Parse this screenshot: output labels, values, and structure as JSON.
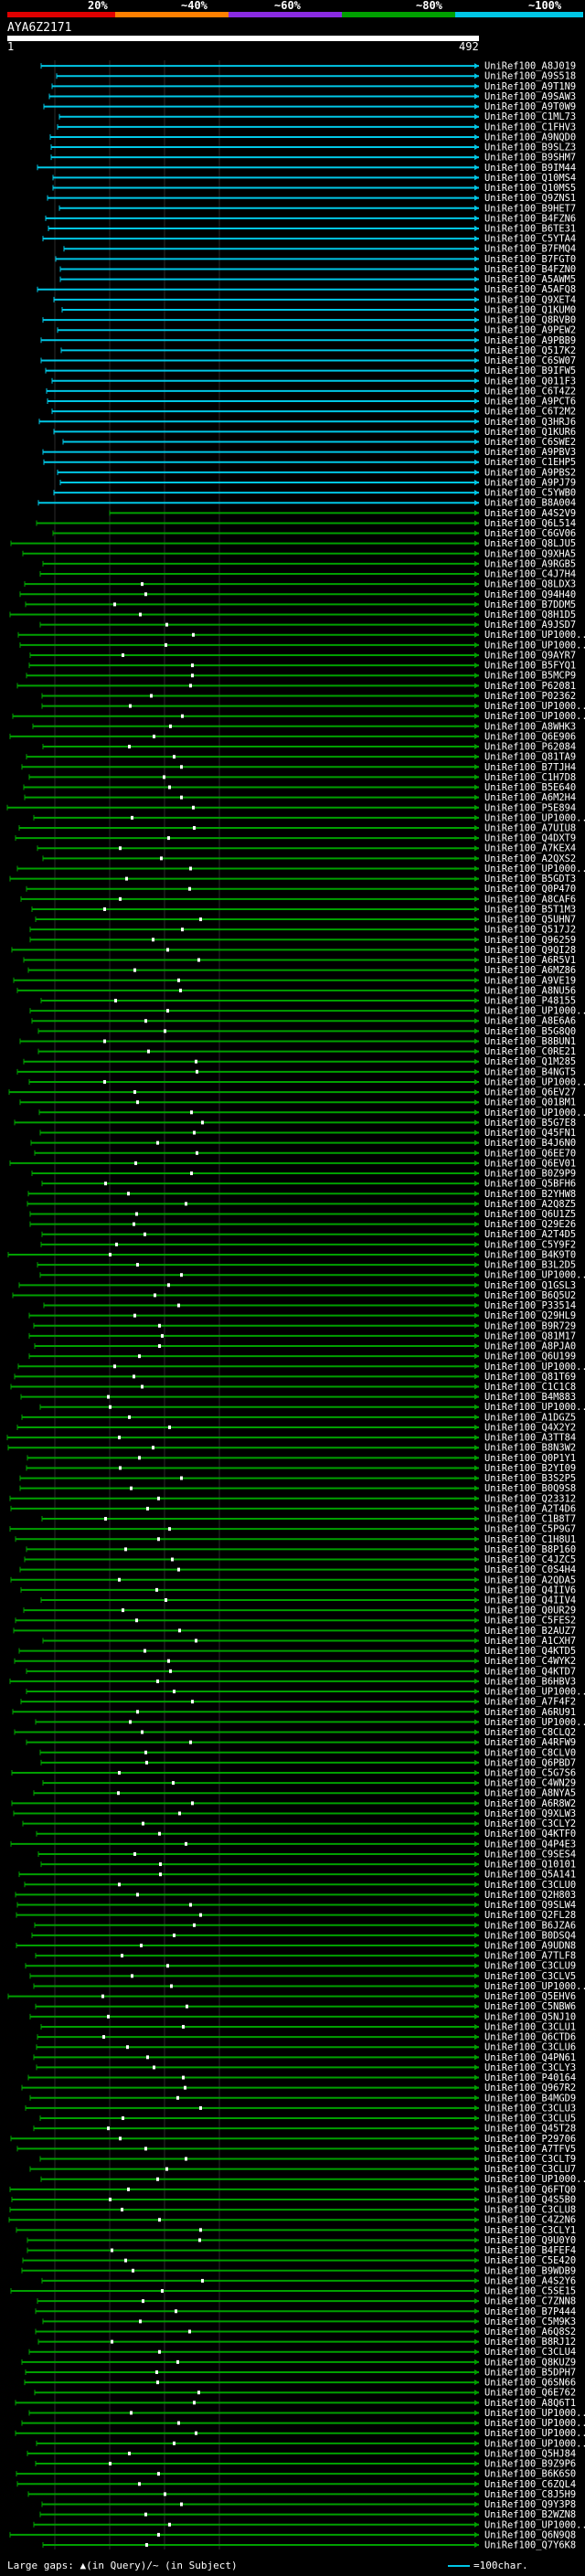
{
  "coverage_scale": {
    "labels": [
      "20%",
      "~40%",
      "~60%",
      "~80%",
      "~100%"
    ],
    "colors": [
      "#e00000",
      "#ff8000",
      "#8a2be2",
      "#00a000",
      "#00c7e6"
    ]
  },
  "query": {
    "name": "AYA6Z2171",
    "start": "1",
    "end": "492"
  },
  "hit_labels": [
    "UniRef100_A8J019",
    "UniRef100_A9S518",
    "UniRef100_A9T1N9",
    "UniRef100_A9SAW3",
    "UniRef100_A9T0W9",
    "UniRef100_C1ML73",
    "UniRef100_C1FHV3",
    "UniRef100_A9NQD0",
    "UniRef100_B9SLZ3",
    "UniRef100_B9SHM7",
    "UniRef100_B9IM44",
    "UniRef100_Q10MS4",
    "UniRef100_Q10MS5",
    "UniRef100_Q9ZNS1",
    "UniRef100_B9HET7",
    "UniRef100_B4FZN6",
    "UniRef100_B6TE31",
    "UniRef100_C5YTA4",
    "UniRef100_B7FMQ4",
    "UniRef100_B7FGT0",
    "UniRef100_B4FZN0",
    "UniRef100_A5AWM5",
    "UniRef100_A5AFQ8",
    "UniRef100_Q9XET4",
    "UniRef100_Q1KUM0",
    "UniRef100_Q8RVB0",
    "UniRef100_A9PEW2",
    "UniRef100_A9PBB9",
    "UniRef100_Q517K2",
    "UniRef100_C6SW07",
    "UniRef100_B9IFW5",
    "UniRef100_Q011F3",
    "UniRef100_C6T4Z2",
    "UniRef100_A9PCT6",
    "UniRef100_C6T2M2",
    "UniRef100_Q3HRJ6",
    "UniRef100_Q1KUR6",
    "UniRef100_C6SWE2",
    "UniRef100_A9PBV3",
    "UniRef100_C1EHP5",
    "UniRef100_A9PBS2",
    "UniRef100_A9PJ79",
    "UniRef100_C5YWB0",
    "UniRef100_B8A004",
    "UniRef100_A4S2V9",
    "UniRef100_Q6L514",
    "UniRef100_C6GV06",
    "UniRef100_Q8LJU5",
    "UniRef100_Q9XHA5",
    "UniRef100_A9RGB5",
    "UniRef100_C4J7H4",
    "UniRef100_Q8LDX3",
    "UniRef100_Q94H40",
    "UniRef100_B7DDM5",
    "UniRef100_Q8H1D5",
    "UniRef100_A9JSD7",
    "UniRef100_UP1000...",
    "UniRef100_UP1000...",
    "UniRef100_Q9AYR7",
    "UniRef100_B5FYQ1",
    "UniRef100_B5MCP9",
    "UniRef100_P62081",
    "UniRef100_P02362",
    "UniRef100_UP1000...",
    "UniRef100_UP1000...",
    "UniRef100_A8WHK3",
    "UniRef100_Q6E906",
    "UniRef100_P62084",
    "UniRef100_Q81TA9",
    "UniRef100_B7TJH4",
    "UniRef100_C1H7D8",
    "UniRef100_B5E640",
    "UniRef100_A6M2H4",
    "UniRef100_P5E894",
    "UniRef100_UP1000...",
    "UniRef100_A7UIU8",
    "UniRef100_Q4DXT9",
    "UniRef100_A7KEX4",
    "UniRef100_A2QXS2",
    "UniRef100_UP1000...",
    "UniRef100_B5GDT3",
    "UniRef100_Q0P470",
    "UniRef100_A8CAF6",
    "UniRef100_B5T1M3",
    "UniRef100_Q5UHN7",
    "UniRef100_Q517J2",
    "UniRef100_Q96259",
    "UniRef100_Q9QI28",
    "UniRef100_A6R5V1",
    "UniRef100_A6MZ86",
    "UniRef100_A9VE19",
    "UniRef100_A8NU56",
    "UniRef100_P48155",
    "UniRef100_UP1000...",
    "UniRef100_A8E6A6",
    "UniRef100_B5G8Q0",
    "UniRef100_B8BUN1",
    "UniRef100_C0RE21",
    "UniRef100_Q1M285",
    "UniRef100_B4NGT5",
    "UniRef100_UP1000...",
    "UniRef100_Q6EV27",
    "UniRef100_Q01BM1",
    "UniRef100_UP1000...",
    "UniRef100_B5G7E8",
    "UniRef100_Q45FN1",
    "UniRef100_B4J6N0",
    "UniRef100_Q6EE70",
    "UniRef100_Q6EV01",
    "UniRef100_B0Z9P9",
    "UniRef100_Q5BFH6",
    "UniRef100_B2YHW8",
    "UniRef100_A2Q8Z5",
    "UniRef100_Q6U1Z5",
    "UniRef100_Q29E26",
    "UniRef100_A2T4D5",
    "UniRef100_C5Y9F2",
    "UniRef100_B4K9T0",
    "UniRef100_B3L2D5",
    "UniRef100_UP1000...",
    "UniRef100_Q1GSL3",
    "UniRef100_B6Q5U2",
    "UniRef100_P33514",
    "UniRef100_Q29HL9",
    "UniRef100_B9R729",
    "UniRef100_Q81M17",
    "UniRef100_A8PJA0",
    "UniRef100_Q6U199",
    "UniRef100_UP1000...",
    "UniRef100_Q81T69",
    "UniRef100_C1C1C8",
    "UniRef100_B4M883",
    "UniRef100_UP1000...",
    "UniRef100_A1DGZ5",
    "UniRef100_Q4X2Y2",
    "UniRef100_A3TT84",
    "UniRef100_B8N3W2",
    "UniRef100_Q0P1Y1",
    "UniRef100_B2YI09",
    "UniRef100_B3S2P5",
    "UniRef100_B0Q9S8",
    "UniRef100_Q23312",
    "UniRef100_A2T4D6",
    "UniRef100_C1B8T7",
    "UniRef100_C5P9G7",
    "UniRef100_C1H8U1",
    "UniRef100_B8P160",
    "UniRef100_C4JZC5",
    "UniRef100_C0S4H4",
    "UniRef100_A2QDA5",
    "UniRef100_Q4IIV6",
    "UniRef100_Q4IIV4",
    "UniRef100_Q0UR29",
    "UniRef100_C5FES2",
    "UniRef100_B2AUZ7",
    "UniRef100_A1CXH7",
    "UniRef100_Q4KTD5",
    "UniRef100_C4WYK2",
    "UniRef100_Q4KTD7",
    "UniRef100_B6HBV3",
    "UniRef100_UP1000...",
    "UniRef100_A7F4F2",
    "UniRef100_A6RU91",
    "UniRef100_UP1000...",
    "UniRef100_C8CLQ2",
    "UniRef100_A4RFW9",
    "UniRef100_C8CLV0",
    "UniRef100_Q6PBD7",
    "UniRef100_C5G7S6",
    "UniRef100_C4WN29",
    "UniRef100_A8NYA5",
    "UniRef100_A6R8W2",
    "UniRef100_Q9XLW3",
    "UniRef100_C3CLY2",
    "UniRef100_Q4KTF0",
    "UniRef100_Q4P4E3",
    "UniRef100_C9SES4",
    "UniRef100_Q10101",
    "UniRef100_Q5A141",
    "UniRef100_C3CLU0",
    "UniRef100_Q2H803",
    "UniRef100_Q9SLW4",
    "UniRef100_Q2FL28",
    "UniRef100_B6JZA6",
    "UniRef100_B0DSQ4",
    "UniRef100_A9UDN8",
    "UniRef100_A7TLF8",
    "UniRef100_C3CLU9",
    "UniRef100_C3CLV5",
    "UniRef100_UP1000...",
    "UniRef100_Q5EHV6",
    "UniRef100_C5NBW6",
    "UniRef100_Q5NJ10",
    "UniRef100_C3CLU1",
    "UniRef100_Q6CTD6",
    "UniRef100_C3CLU6",
    "UniRef100_Q4PN61",
    "UniRef100_C3CLY3",
    "UniRef100_P40164",
    "UniRef100_Q967R2",
    "UniRef100_B4MGD9",
    "UniRef100_C3CLU3",
    "UniRef100_C3CLU5",
    "UniRef100_Q45T28",
    "UniRef100_P29706",
    "UniRef100_A7TFV5",
    "UniRef100_C3CLT9",
    "UniRef100_C3CLU7",
    "UniRef100_UP1000...",
    "UniRef100_Q6FTQ0",
    "UniRef100_Q4S5B0",
    "UniRef100_C3CLU8",
    "UniRef100_C4Z2N6",
    "UniRef100_C3CLY1",
    "UniRef100_Q9U0Y0",
    "UniRef100_B4FEF4",
    "UniRef100_C5E420",
    "UniRef100_B9WDB9",
    "UniRef100_A4S2Y6",
    "UniRef100_C5SE15",
    "UniRef100_C7ZNN8",
    "UniRef100_B7P444",
    "UniRef100_C5M9K3",
    "UniRef100_A6Q8S2",
    "UniRef100_B8RJ12",
    "UniRef100_C3CLU4",
    "UniRef100_Q8KUZ9",
    "UniRef100_B5DPH7",
    "UniRef100_Q6SN66",
    "UniRef100_Q6E762",
    "UniRef100_A8Q6T1",
    "UniRef100_UP1000...",
    "UniRef100_UP1000...",
    "UniRef100_UP1000...",
    "UniRef100_UP1000...",
    "UniRef100_Q5HJ84",
    "UniRef100_B9Z9P6",
    "UniRef100_B6K6S0",
    "UniRef100_C6ZQL4",
    "UniRef100_C8J5H9",
    "UniRef100_Q9Y3P8",
    "UniRef100_B2WZN8",
    "UniRef100_UP1000...",
    "UniRef100_Q6N9Q8",
    "UniRef100_Q7Y6K8"
  ],
  "footer": {
    "legend_text": "Large gaps: ▲(in Query)/~ (in Subject)",
    "scale_label": "=100char."
  }
}
